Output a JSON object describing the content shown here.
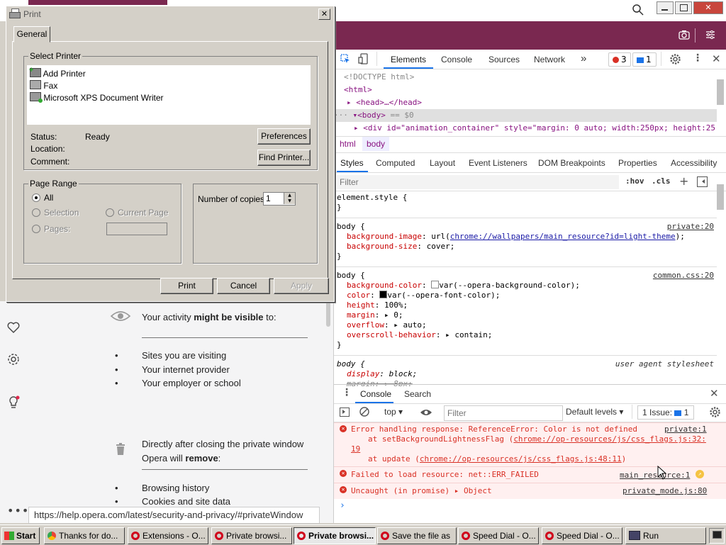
{
  "dialog": {
    "title": "Print",
    "close_glyph": "✕",
    "tab_general": "General",
    "select_printer_label": "Select Printer",
    "printers": [
      "Add Printer",
      "Fax",
      "Microsoft XPS Document Writer"
    ],
    "status_label": "Status:",
    "status_value": "Ready",
    "location_label": "Location:",
    "comment_label": "Comment:",
    "preferences_button": "Preferences",
    "find_printer_button": "Find Printer...",
    "page_range_label": "Page Range",
    "all_label": "All",
    "selection_label": "Selection",
    "current_page_label": "Current Page",
    "pages_label": "Pages:",
    "copies_label": "Number of copies:",
    "copies_value": "1",
    "print_button": "Print",
    "cancel_button": "Cancel",
    "apply_button": "Apply"
  },
  "page": {
    "activity_text_pre": "Your activity ",
    "activity_text_bold": "might be visible",
    "activity_text_post": " to:",
    "visible_list": [
      "Sites you are visiting",
      "Your internet provider",
      "Your employer or school"
    ],
    "closing_text_1": "Directly after closing the private window",
    "closing_text_2_pre": "Opera will ",
    "closing_text_2_bold": "remove",
    "closing_text_2_post": ":",
    "remove_list": [
      "Browsing history",
      "Cookies and site data"
    ],
    "status_url": "https://help.opera.com/latest/security-and-privacy/#privateWindow"
  },
  "devtools": {
    "tabs": [
      "Elements",
      "Console",
      "Sources",
      "Network"
    ],
    "more": "»",
    "error_count": "3",
    "message_count": "1",
    "dom_lines": {
      "doctype": "<!DOCTYPE html>",
      "html_open": "<html>",
      "head": "<head>…</head>",
      "body": "<body>",
      "body_eq": "== $0",
      "div": "<div id=\"animation_container\" style=\"margin: 0 auto; width:250px; height:25"
    },
    "breadcrumb": [
      "html",
      "body"
    ],
    "style_tabs": [
      "Styles",
      "Computed",
      "Layout",
      "Event Listeners",
      "DOM Breakpoints",
      "Properties",
      "Accessibility"
    ],
    "filter_placeholder": "Filter",
    "hov": ":hov",
    "cls": ".cls",
    "rules": {
      "element_style": "element.style {",
      "close": "}",
      "body_sel": "body {",
      "private_src": "private:20",
      "bg_image_prop": "background-image",
      "bg_image_url": "chrome://wallpapers/main_resource?id=light-theme",
      "bg_size_prop": "background-size",
      "bg_size_val": "cover;",
      "common_src": "common.css:20",
      "bgc_prop": "background-color",
      "bgc_val": "var(--opera-background-color);",
      "color_prop": "color",
      "color_val": "var(--opera-font-color);",
      "height_prop": "height",
      "height_val": "100%;",
      "margin_prop": "margin",
      "margin_val": "0;",
      "overflow_prop": "overflow",
      "overflow_val": "auto;",
      "overscroll_prop": "overscroll-behavior",
      "overscroll_val": "contain;",
      "ua_src": "user agent stylesheet",
      "display_prop": "display",
      "display_val": "block;",
      "ua_margin": "margin: ▸ 8px;"
    },
    "drawer_tabs": [
      "Console",
      "Search"
    ],
    "console_context": "top",
    "console_filter": "Filter",
    "default_levels": "Default levels",
    "issues_label": "1 Issue:",
    "issues_count": "1",
    "messages": {
      "m1_text": "Error handling response: ReferenceError: Color is not defined",
      "m1_src": "private:1",
      "m1_at1_pre": "at setBackgroundLightnessFlag (",
      "m1_at1_link": "chrome://op-resources/js/css_flags.js:32:",
      "m1_at1_link2": "19",
      "m1_at2_pre": "at update (",
      "m1_at2_link": "chrome://op-resources/js/css_flags.js:48:11",
      "m2_text": "Failed to load resource: net::ERR_FAILED",
      "m2_src": "main_resource:1",
      "m3_text": "Uncaught (in promise) ▸ Object",
      "m3_src": "private_mode.js:80"
    },
    "prompt": "›"
  },
  "taskbar": {
    "start": "Start",
    "items": [
      "Thanks for do...",
      "Extensions - O...",
      "Private browsi...",
      "Private browsi...",
      "Save the file as",
      "Speed Dial - O...",
      "Speed Dial - O...",
      "Run"
    ]
  }
}
